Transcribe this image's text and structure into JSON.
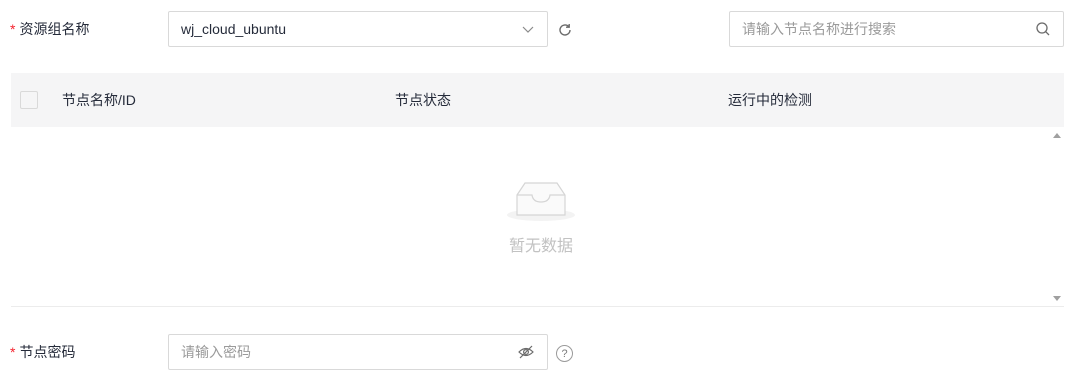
{
  "resource_group": {
    "required_mark": "*",
    "label": "资源组名称",
    "selected_value": "wj_cloud_ubuntu"
  },
  "node_search": {
    "placeholder": "请输入节点名称进行搜索"
  },
  "table": {
    "columns": [
      "节点名称/ID",
      "节点状态",
      "运行中的检测"
    ],
    "empty_text": "暂无数据"
  },
  "node_password": {
    "required_mark": "*",
    "label": "节点密码",
    "placeholder": "请输入密码"
  },
  "icons": {
    "select_arrow": "chevron-down-icon",
    "refresh": "refresh-icon",
    "search": "search-icon",
    "empty": "empty-box-icon",
    "password_toggle": "eye-off-icon",
    "help": "help-circle-icon",
    "help_glyph": "?"
  },
  "colors": {
    "required": "#f5222d",
    "border": "#d9d9d9",
    "header_bg": "#f5f5f6",
    "placeholder": "#9a9a9a",
    "empty_text": "#c2c2c2"
  }
}
